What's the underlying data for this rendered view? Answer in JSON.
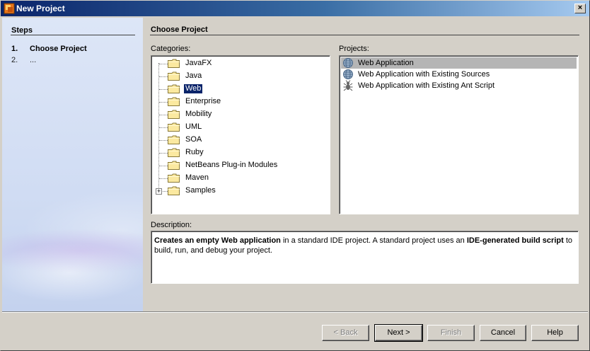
{
  "window": {
    "title": "New Project",
    "close_glyph": "×"
  },
  "steps": {
    "title": "Steps",
    "items": [
      {
        "num": "1.",
        "label": "Choose Project"
      },
      {
        "num": "2.",
        "label": "..."
      }
    ]
  },
  "main": {
    "title": "Choose Project"
  },
  "categories": {
    "label": "Categories:",
    "items": [
      {
        "label": "JavaFX",
        "selected": false
      },
      {
        "label": "Java",
        "selected": false
      },
      {
        "label": "Web",
        "selected": true
      },
      {
        "label": "Enterprise",
        "selected": false
      },
      {
        "label": "Mobility",
        "selected": false
      },
      {
        "label": "UML",
        "selected": false
      },
      {
        "label": "SOA",
        "selected": false
      },
      {
        "label": "Ruby",
        "selected": false
      },
      {
        "label": "NetBeans Plug-in Modules",
        "selected": false
      },
      {
        "label": "Maven",
        "selected": false
      },
      {
        "label": "Samples",
        "selected": false,
        "expandable": true
      }
    ],
    "expander_glyph": "+"
  },
  "projects": {
    "label": "Projects:",
    "items": [
      {
        "label": "Web Application",
        "icon": "globe-icon",
        "selected": true
      },
      {
        "label": "Web Application with Existing Sources",
        "icon": "globe-icon",
        "selected": false
      },
      {
        "label": "Web Application with Existing Ant Script",
        "icon": "ant-icon",
        "selected": false
      }
    ]
  },
  "description": {
    "label": "Description:",
    "parts": [
      {
        "text": "Creates an empty Web application",
        "bold": true
      },
      {
        "text": " in a standard IDE project. A standard project uses an ",
        "bold": false
      },
      {
        "text": "IDE-generated build script",
        "bold": true
      },
      {
        "text": " to build, run, and debug your project.",
        "bold": false
      }
    ]
  },
  "buttons": {
    "back": "< Back",
    "next": "Next >",
    "finish": "Finish",
    "cancel": "Cancel",
    "help": "Help"
  },
  "colors": {
    "selection": "#0a246a",
    "project_selection": "#b5b5b5",
    "dialog_bg": "#d4d0c8",
    "title_bar": "#0a246a"
  }
}
